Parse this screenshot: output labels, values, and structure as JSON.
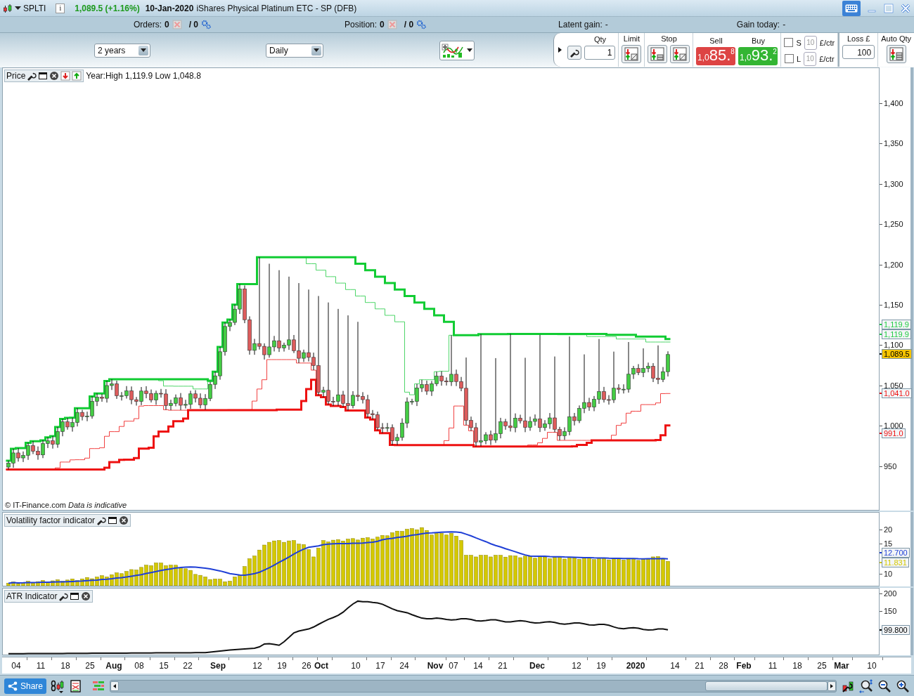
{
  "title_bar": {
    "symbol": "SPLTI",
    "info": "i",
    "price_change": "1,089.5 (+1.16%)",
    "date": "10-Jan-2020",
    "instrument": "iShares Physical Platinum ETC - SP (DFB)"
  },
  "info_bar": {
    "orders_label": "Orders:",
    "orders_value": "0",
    "orders_total": "/ 0",
    "position_label": "Position:",
    "position_value": "0",
    "position_total": "/ 0",
    "latent_label": "Latent gain:",
    "latent_value": "-",
    "gain_today_label": "Gain today:",
    "gain_today_value": "-"
  },
  "toolbar": {
    "period": "2 years",
    "interval": "Daily"
  },
  "order_panel": {
    "qty_label": "Qty",
    "qty": "1",
    "limit_label": "Limit",
    "stop_label": "Stop",
    "sell": {
      "label": "Sell",
      "prefix": "1,0",
      "main": "85.",
      "suffix": "8"
    },
    "buy": {
      "label": "Buy",
      "prefix": "1,0",
      "main": "93.",
      "suffix": "2"
    },
    "guards": [
      {
        "letter": "S",
        "checked": false,
        "amount": "10",
        "disabled": true,
        "unit": "£/ctr"
      },
      {
        "letter": "L",
        "checked": false,
        "amount": "10",
        "disabled": true,
        "unit": "£/ctr"
      }
    ],
    "loss_label": "Loss £",
    "loss": "100",
    "auto_qty_label": "Auto Qty"
  },
  "price_panel": {
    "title": "Price",
    "year_range": "Year:High 1,119.9 Low 1,048.8",
    "credit": "© IT-Finance.com *Data is indicative*",
    "ticks": [
      "1,400",
      "1,350",
      "1,300",
      "1,250",
      "1,200",
      "1,150",
      "1,100",
      "1,050",
      "1,000",
      "950"
    ],
    "markers": [
      {
        "text": "1,119.9",
        "color": "#22cc44",
        "kind": "level"
      },
      {
        "text": "1,119.9",
        "color": "#22cc44",
        "kind": "level"
      },
      {
        "text": "1,089.5",
        "color": "#000000",
        "kind": "current"
      },
      {
        "text": "1,041.0",
        "color": "#ee1111",
        "kind": "level"
      },
      {
        "text": "991.0",
        "color": "#ee1111",
        "kind": "level"
      }
    ]
  },
  "volatility_panel": {
    "title": "Volatility factor indicator",
    "ticks": [
      "20",
      "15",
      "10"
    ],
    "markers": [
      {
        "text": "12.700",
        "color": "#1f3fd6"
      },
      {
        "text": "11.831",
        "color": "#d4c800"
      }
    ]
  },
  "atr_panel": {
    "title": "ATR Indicator",
    "ticks": [
      "200",
      "150"
    ],
    "markers": [
      {
        "text": "99.800",
        "color": "#000000"
      }
    ]
  },
  "x_axis": [
    {
      "text": "04",
      "kind": "day"
    },
    {
      "text": "11",
      "kind": "day"
    },
    {
      "text": "18",
      "kind": "day"
    },
    {
      "text": "25",
      "kind": "day"
    },
    {
      "text": "Aug",
      "kind": "month"
    },
    {
      "text": "08",
      "kind": "day"
    },
    {
      "text": "15",
      "kind": "day"
    },
    {
      "text": "22",
      "kind": "day"
    },
    {
      "text": "Sep",
      "kind": "month"
    },
    {
      "text": "12",
      "kind": "day"
    },
    {
      "text": "19",
      "kind": "day"
    },
    {
      "text": "26",
      "kind": "day"
    },
    {
      "text": "Oct",
      "kind": "month"
    },
    {
      "text": "10",
      "kind": "day"
    },
    {
      "text": "17",
      "kind": "day"
    },
    {
      "text": "24",
      "kind": "day"
    },
    {
      "text": "Nov",
      "kind": "month"
    },
    {
      "text": "07",
      "kind": "day"
    },
    {
      "text": "14",
      "kind": "day"
    },
    {
      "text": "21",
      "kind": "day"
    },
    {
      "text": "Dec",
      "kind": "month"
    },
    {
      "text": "12",
      "kind": "day"
    },
    {
      "text": "19",
      "kind": "day"
    },
    {
      "text": "2020",
      "kind": "month"
    },
    {
      "text": "14",
      "kind": "day"
    },
    {
      "text": "21",
      "kind": "day"
    },
    {
      "text": "28",
      "kind": "day"
    },
    {
      "text": "Feb",
      "kind": "month"
    },
    {
      "text": "11",
      "kind": "day"
    },
    {
      "text": "18",
      "kind": "day"
    },
    {
      "text": "25",
      "kind": "day"
    },
    {
      "text": "Mar",
      "kind": "month"
    },
    {
      "text": "10",
      "kind": "day"
    }
  ],
  "bottom_bar": {
    "share": "Share"
  }
}
